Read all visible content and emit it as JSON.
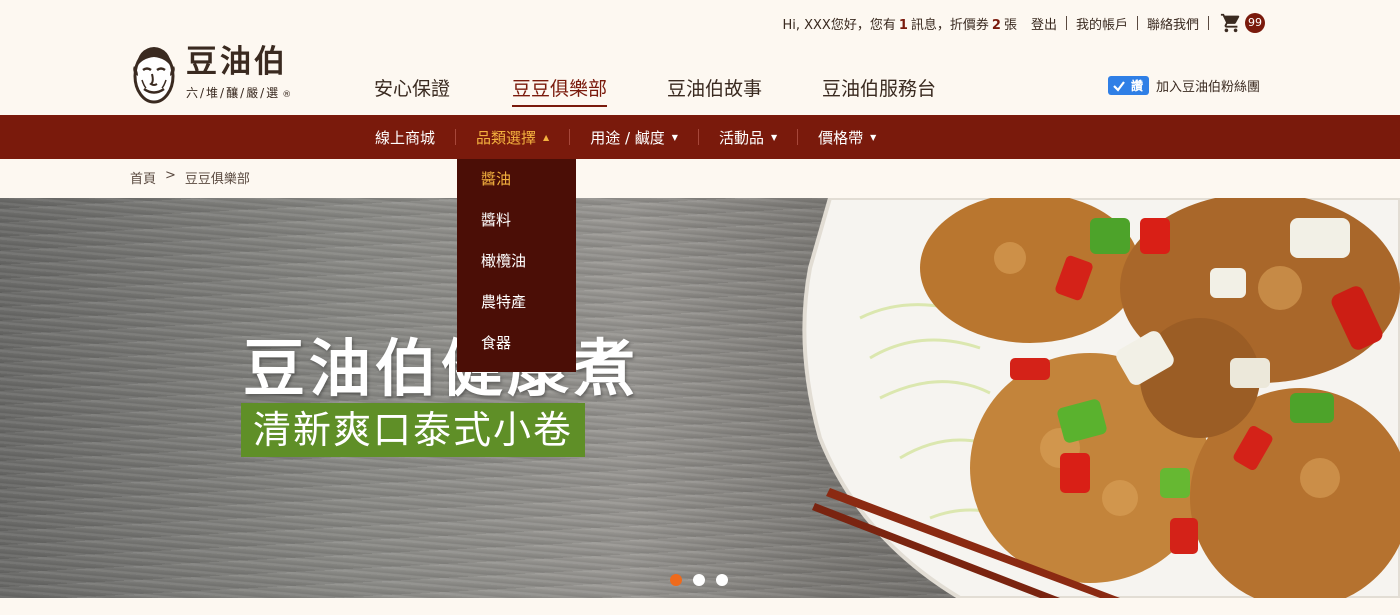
{
  "util": {
    "greeting_prefix": "Hi, XXX您好，您有",
    "message_count": "1",
    "greeting_mid": "訊息，折價券",
    "coupon_count": "2",
    "greeting_suffix": "張",
    "logout": "登出",
    "account": "我的帳戶",
    "contact": "聯絡我們",
    "cart_icon": "cart-icon",
    "cart_count": "99"
  },
  "logo": {
    "title": "豆油伯",
    "subtitle": "六/堆/釀/嚴/選",
    "registered": "®"
  },
  "mainnav": {
    "items": [
      {
        "label": "安心保證"
      },
      {
        "label": "豆豆俱樂部",
        "active": true
      },
      {
        "label": "豆油伯故事"
      },
      {
        "label": "豆油伯服務台"
      }
    ]
  },
  "fan": {
    "button_label": "讚",
    "text": "加入豆油伯粉絲團"
  },
  "subnav": {
    "items": [
      {
        "label": "線上商城"
      },
      {
        "label": "品類選擇",
        "caret": "▲",
        "active": true
      },
      {
        "label": "用途 / 鹹度",
        "caret": "▼"
      },
      {
        "label": "活動品",
        "caret": "▼"
      },
      {
        "label": "價格帶",
        "caret": "▼"
      }
    ]
  },
  "dropdown": {
    "items": [
      {
        "label": "醬油",
        "active": true
      },
      {
        "label": "醬料"
      },
      {
        "label": "橄欖油"
      },
      {
        "label": "農特產"
      },
      {
        "label": "食器"
      }
    ]
  },
  "breadcrumb": {
    "home": "首頁",
    "separator": ">",
    "current": "豆豆俱樂部"
  },
  "hero": {
    "title": "豆油伯健康煮",
    "subtitle": "清新爽口泰式小卷",
    "slides": 3,
    "active_slide": 1
  },
  "colors": {
    "brand": "#7a1a0c",
    "dropdown_bg": "#4b0e06",
    "accent": "#f4b23f",
    "fan_blue": "#2f7fe6",
    "subtitle_green": "#5f8f27",
    "dot_active": "#ef6a1b"
  }
}
